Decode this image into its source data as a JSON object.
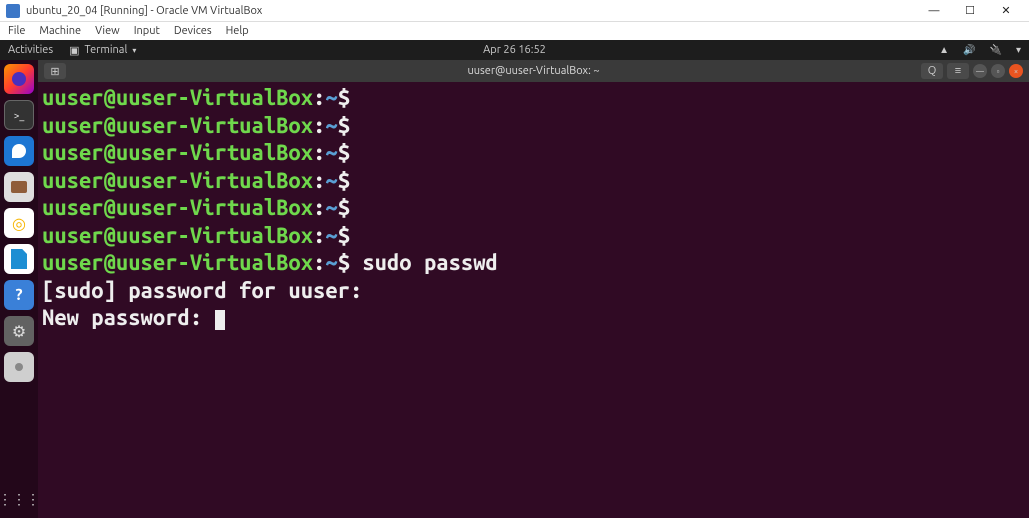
{
  "host": {
    "title": "ubuntu_20_04 [Running] - Oracle VM VirtualBox",
    "menu": [
      "File",
      "Machine",
      "View",
      "Input",
      "Devices",
      "Help"
    ],
    "min": "—",
    "max": "☐",
    "close": "✕"
  },
  "gnome": {
    "activities": "Activities",
    "app_label": "Terminal",
    "clock": "Apr 26  16:52",
    "status_net": "▲",
    "status_vol": "🔊",
    "status_power": "🔌",
    "status_caret": "▾"
  },
  "termbar": {
    "newtab": "⊞",
    "title": "uuser@uuser-VirtualBox: ~",
    "search": "Q",
    "menu": "≡"
  },
  "dock": {
    "apps": [
      {
        "name": "firefox"
      },
      {
        "name": "terminal"
      },
      {
        "name": "thunderbird"
      },
      {
        "name": "files"
      },
      {
        "name": "rhythmbox"
      },
      {
        "name": "libreoffice-writer"
      },
      {
        "name": "help"
      },
      {
        "name": "settings"
      },
      {
        "name": "disc"
      }
    ],
    "show_apps": "⋮⋮⋮"
  },
  "terminal": {
    "prompt_user": "uuser@uuser-VirtualBox",
    "prompt_sep_host": ":",
    "prompt_path": "~",
    "prompt_symbol": "$",
    "lines": [
      {
        "cmd": ""
      },
      {
        "cmd": ""
      },
      {
        "cmd": ""
      },
      {
        "cmd": ""
      },
      {
        "cmd": ""
      },
      {
        "cmd": ""
      },
      {
        "cmd": "sudo passwd"
      }
    ],
    "output": [
      "[sudo] password for uuser: ",
      "New password: "
    ]
  }
}
